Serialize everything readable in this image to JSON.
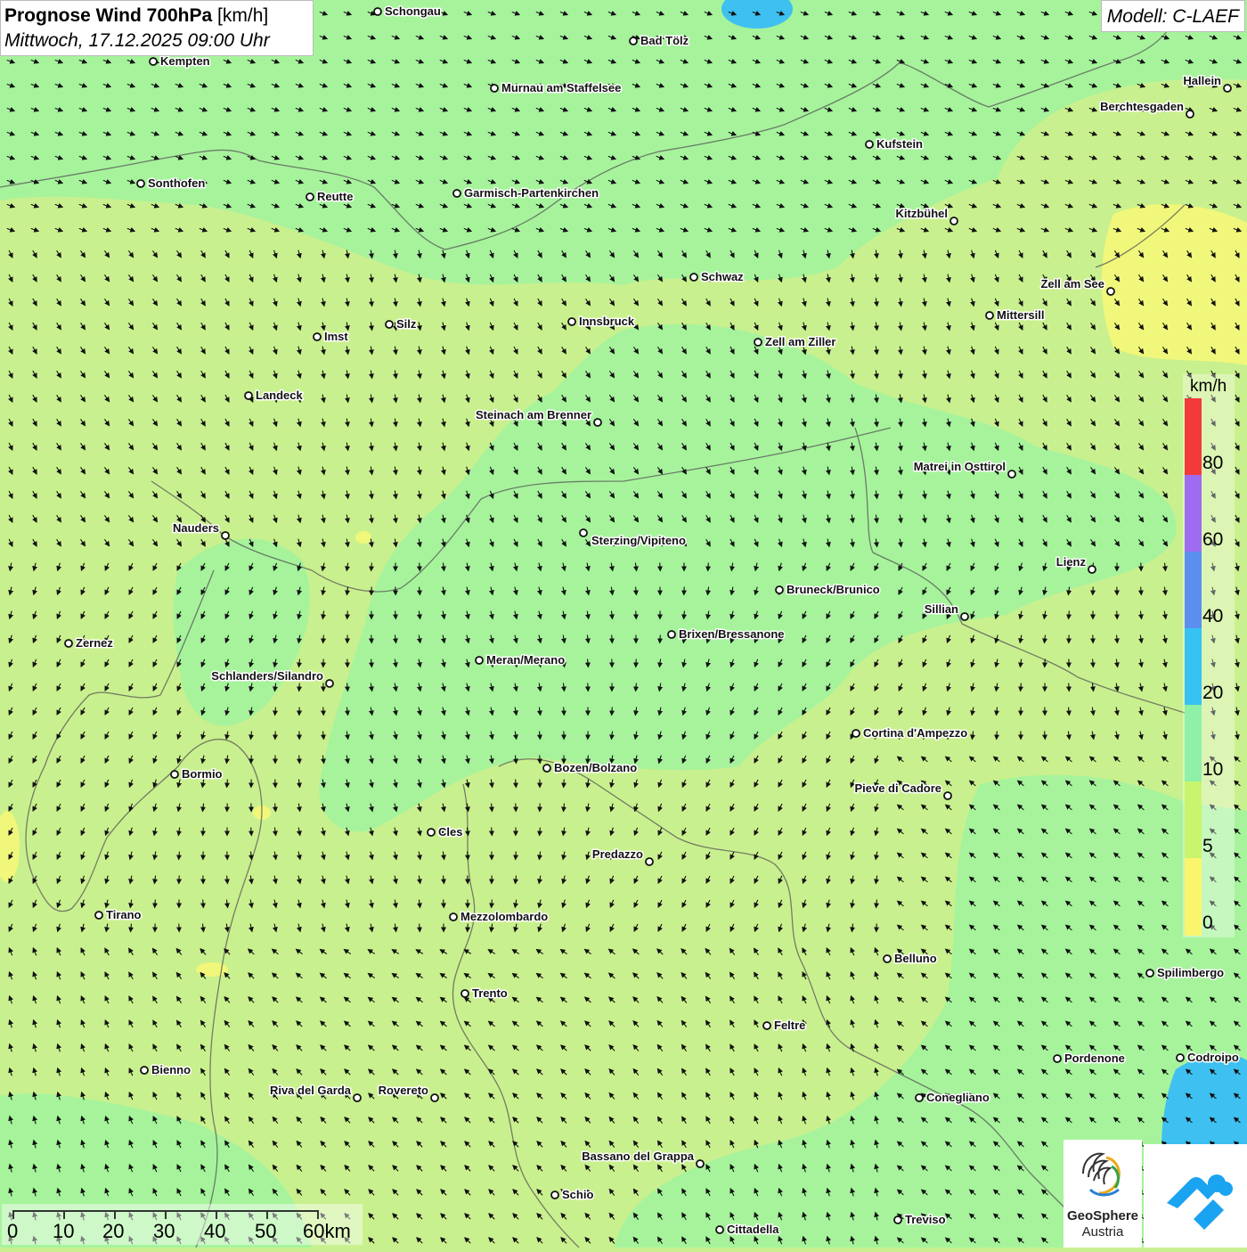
{
  "header": {
    "title_bold": "Prognose Wind 700hPa",
    "title_unit": "[km/h]",
    "datetime": "Mittwoch, 17.12.2025 09:00 Uhr"
  },
  "model_label": "Modell: C-LAEF",
  "legend": {
    "unit": "km/h",
    "labels": [
      "80",
      "60",
      "40",
      "20",
      "10",
      "5",
      "0"
    ],
    "colors": [
      "#f23a3a",
      "#9d6cf0",
      "#5a8ff0",
      "#36c2f2",
      "#8ff0a8",
      "#c9f56e",
      "#fbf56e"
    ]
  },
  "scale_bar": {
    "labels": [
      "0",
      "10",
      "20",
      "30",
      "40",
      "50",
      "60km"
    ]
  },
  "logos": {
    "geosphere_line1": "GeoSphere",
    "geosphere_line2": "Austria"
  },
  "cities": [
    {
      "name": "Schongau"
    },
    {
      "name": "Bad Tölz"
    },
    {
      "name": "Kempten"
    },
    {
      "name": "Murnau am Staffelsee"
    },
    {
      "name": "Hallein"
    },
    {
      "name": "Berchtesgaden"
    },
    {
      "name": "Kufstein"
    },
    {
      "name": "Sonthofen"
    },
    {
      "name": "Reutte"
    },
    {
      "name": "Garmisch-Partenkirchen"
    },
    {
      "name": "Kitzbühel"
    },
    {
      "name": "Schwaz"
    },
    {
      "name": "Zell am See"
    },
    {
      "name": "Mittersill"
    },
    {
      "name": "Innsbruck"
    },
    {
      "name": "Silz"
    },
    {
      "name": "Imst"
    },
    {
      "name": "Zell am Ziller"
    },
    {
      "name": "Landeck"
    },
    {
      "name": "Steinach am Brenner"
    },
    {
      "name": "Matrei in Osttirol"
    },
    {
      "name": "Nauders"
    },
    {
      "name": "Sterzing/Vipiteno"
    },
    {
      "name": "Lienz"
    },
    {
      "name": "Bruneck/Brunico"
    },
    {
      "name": "Sillian"
    },
    {
      "name": "Zernez"
    },
    {
      "name": "Brixen/Bressanone"
    },
    {
      "name": "Meran/Merano"
    },
    {
      "name": "Schlanders/Silandro"
    },
    {
      "name": "Cortina d'Ampezzo"
    },
    {
      "name": "Bormio"
    },
    {
      "name": "Bozen/Bolzano"
    },
    {
      "name": "Pieve di Cadore"
    },
    {
      "name": "Cles"
    },
    {
      "name": "Predazzo"
    },
    {
      "name": "Tirano"
    },
    {
      "name": "Mezzolombardo"
    },
    {
      "name": "Belluno"
    },
    {
      "name": "Spilimbergo"
    },
    {
      "name": "Trento"
    },
    {
      "name": "Feltre"
    },
    {
      "name": "Bienno"
    },
    {
      "name": "Pordenone"
    },
    {
      "name": "Codroipo"
    },
    {
      "name": "Riva del Garda"
    },
    {
      "name": "Rovereto"
    },
    {
      "name": "Conegliano"
    },
    {
      "name": "Bassano del Grappa"
    },
    {
      "name": "Schio"
    },
    {
      "name": "Treviso"
    },
    {
      "name": "Cittadella"
    }
  ]
}
